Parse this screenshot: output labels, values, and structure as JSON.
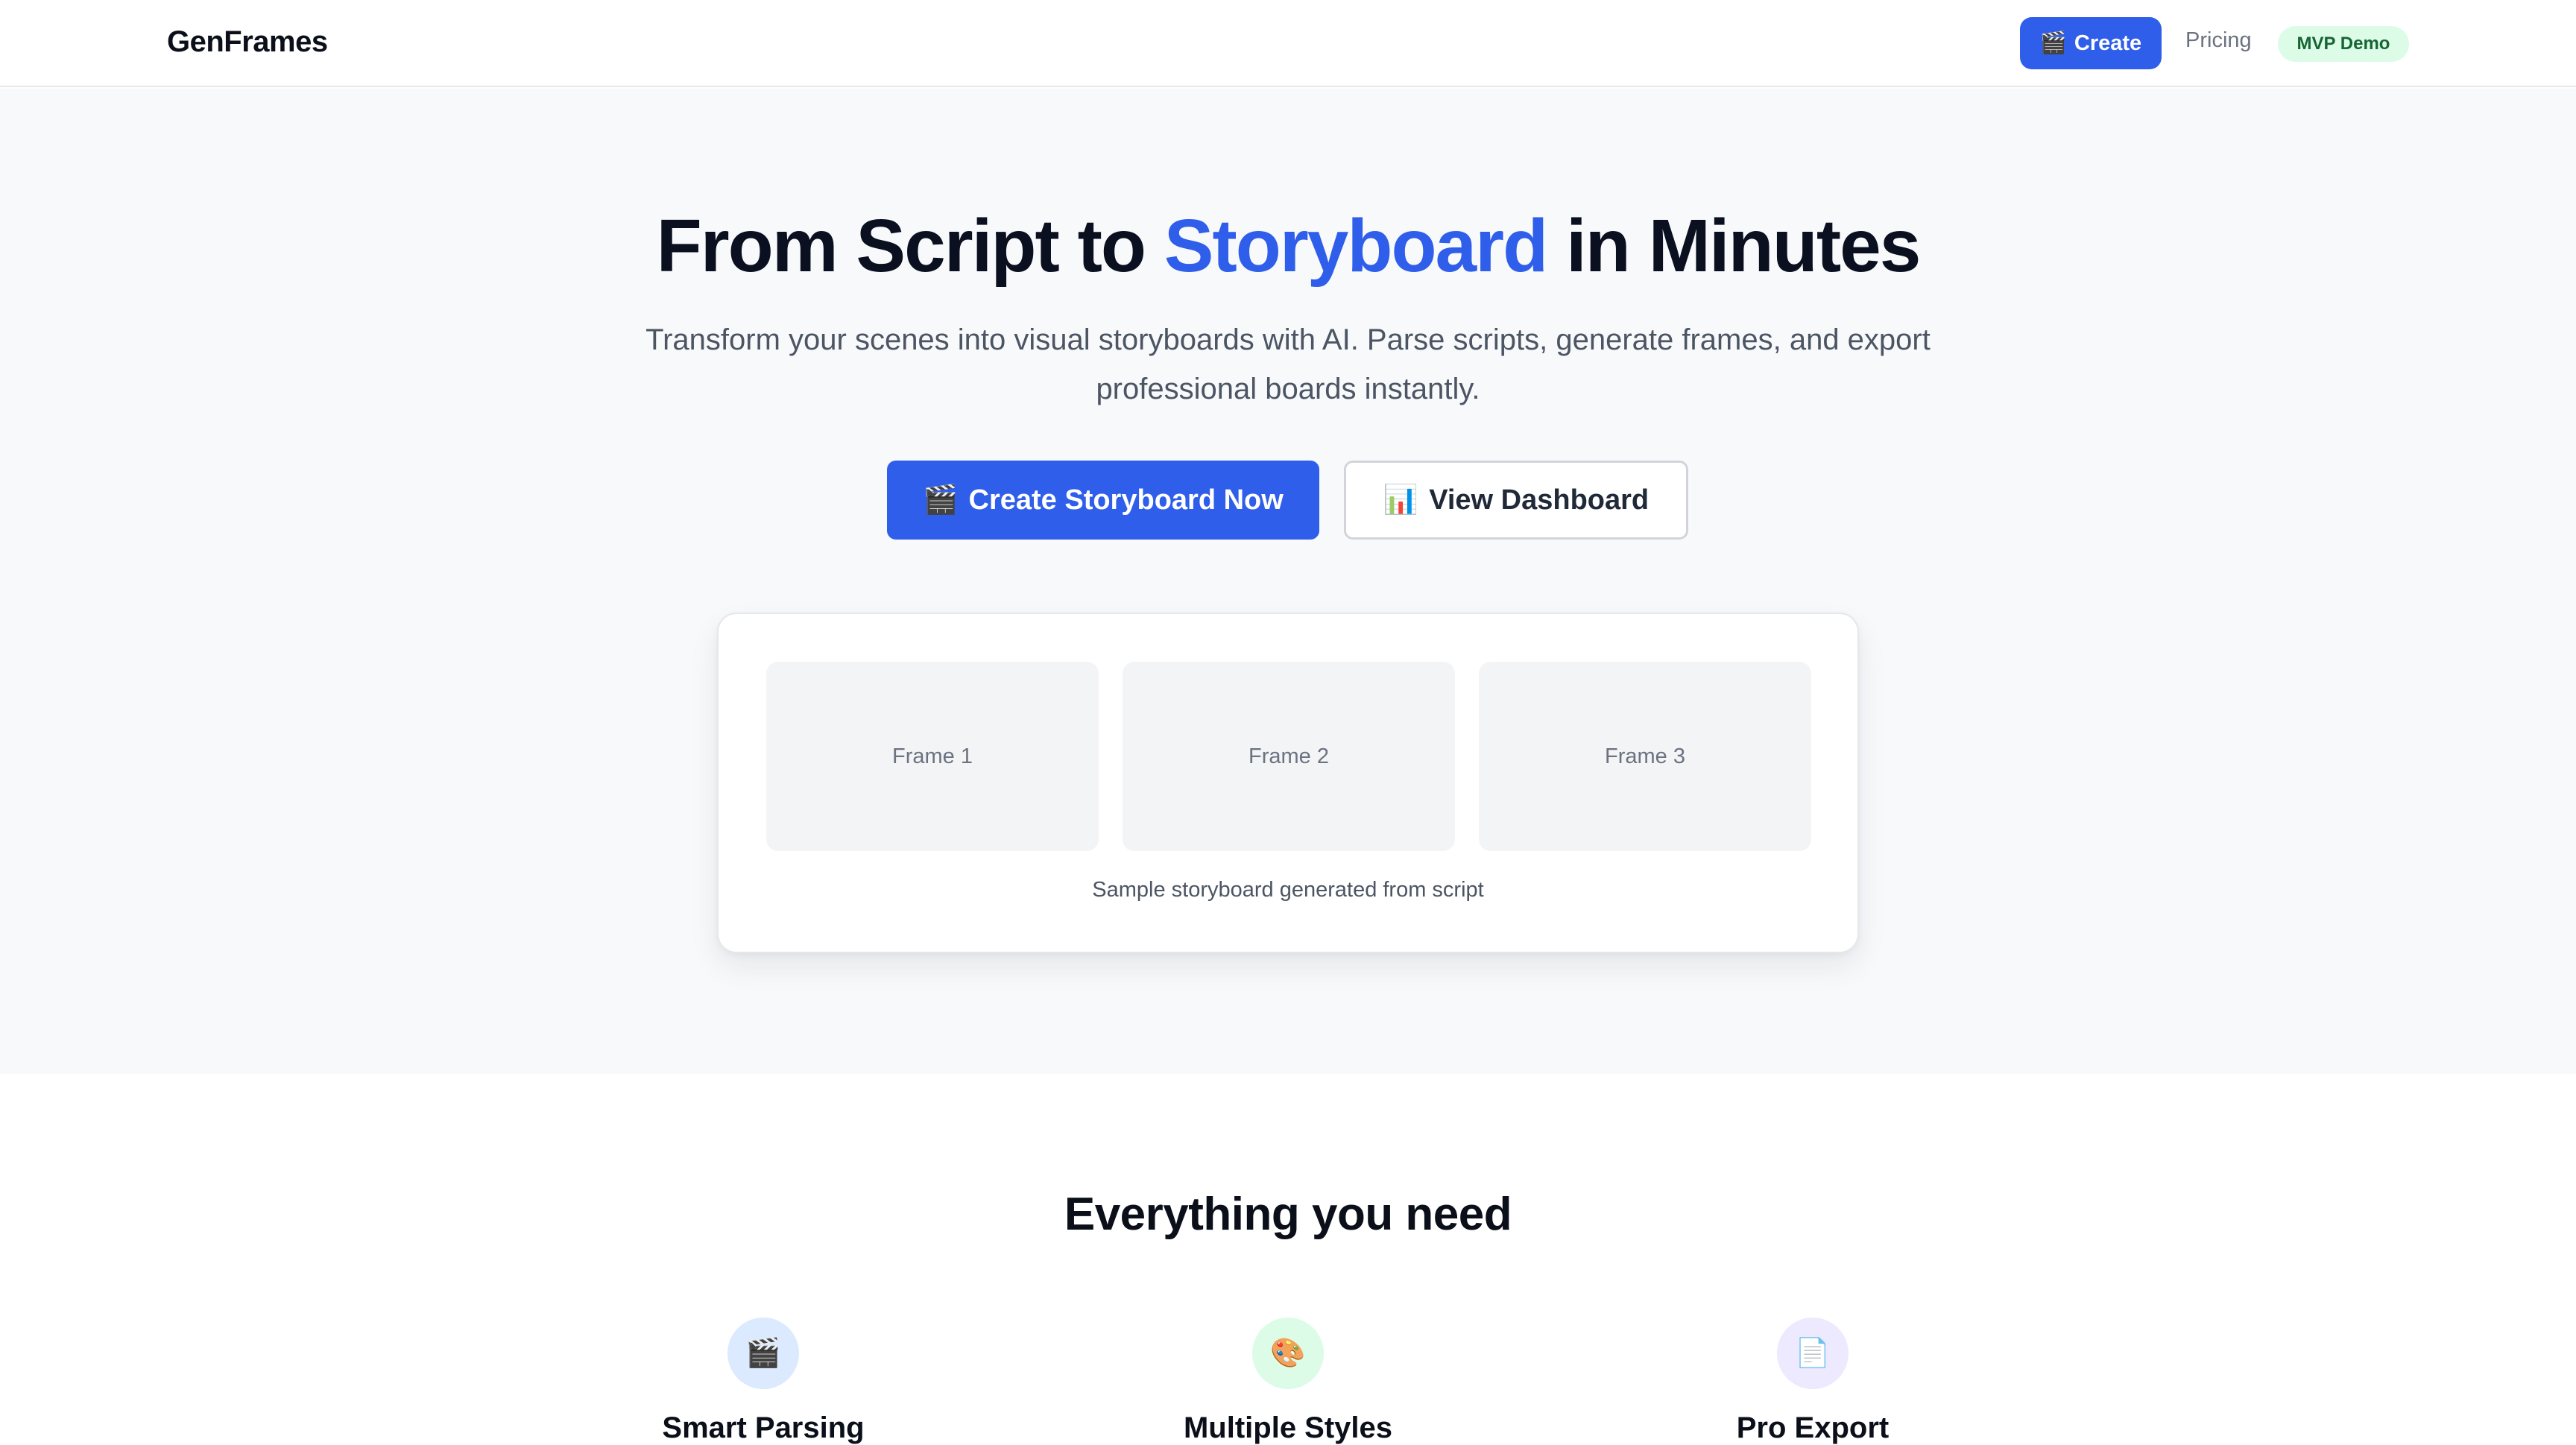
{
  "nav": {
    "brand": "GenFrames",
    "create_icon": "clapperboard-icon",
    "create_label": "Create",
    "pricing_label": "Pricing",
    "badge": "MVP Demo"
  },
  "hero": {
    "title_before": "From Script to ",
    "title_accent": "Storyboard",
    "title_after": " in Minutes",
    "subtitle": "Transform your scenes into visual storyboards with AI. Parse scripts, generate frames, and export professional boards instantly.",
    "primary_icon": "clapperboard-icon",
    "primary_label": "Create Storyboard Now",
    "secondary_icon": "bar-chart-icon",
    "secondary_label": "View Dashboard",
    "frames": [
      "Frame 1",
      "Frame 2",
      "Frame 3"
    ],
    "caption": "Sample storyboard generated from script"
  },
  "features": {
    "title": "Everything you need",
    "items": [
      {
        "icon": "clapperboard-icon",
        "label": "Smart Parsing"
      },
      {
        "icon": "palette-icon",
        "label": "Multiple Styles"
      },
      {
        "icon": "document-icon",
        "label": "Pro Export"
      }
    ]
  },
  "colors": {
    "accent": "#2f5eea",
    "badge_bg": "#dcfce7",
    "badge_text": "#166534"
  }
}
